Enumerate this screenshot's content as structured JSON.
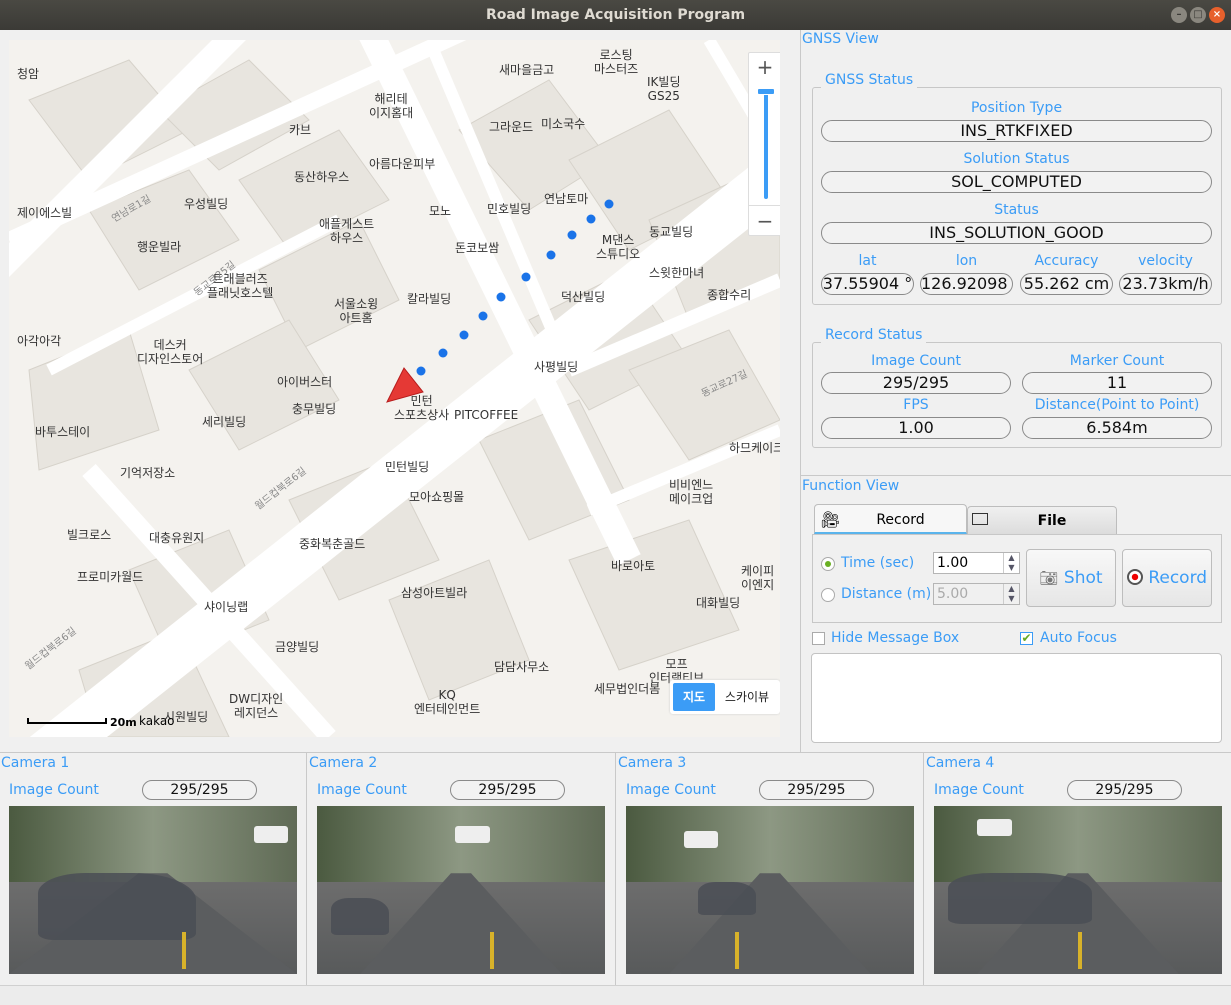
{
  "window": {
    "title": "Road Image Acquisition Program"
  },
  "map": {
    "zoom_in": "+",
    "zoom_out": "−",
    "map_type": {
      "map": "지도",
      "skyview": "스카이뷰",
      "selected": "지도"
    },
    "scale": "20m",
    "brand": "kakao",
    "labels": [
      "청암",
      "해리테\n이지홈대",
      "새마을금고",
      "로스팅\n마스터즈",
      "IK빌딩\nGS25",
      "카브",
      "그라운드",
      "미소국수",
      "아름다운피부",
      "동산하우스",
      "제이에스빌",
      "우성빌딩",
      "연남토마",
      "민호빌딩",
      "모노",
      "애플게스트\n하우스",
      "돈코보쌈",
      "M댄스\n스튜디오",
      "동교빌딩",
      "행운빌라",
      "트래블러즈\n플래닛호스텔",
      "스윗한마녀",
      "종합수리",
      "서울소윙\n아트홈",
      "칼라빌딩",
      "덕산빌딩",
      "아각아각",
      "데스커\n디자인스토어",
      "아이버스터",
      "사평빌딩",
      "충무빌딩",
      "세리빌딩",
      "바투스테이",
      "민턴\n스포츠상사",
      "PITCOFFEE",
      "하므케이크",
      "민턴빌딩",
      "기억저장소",
      "모아쇼핑몰",
      "비비엔느\n메이크업",
      "빌크로스",
      "대충유원지",
      "중화복춘골드",
      "바로아토",
      "케이피\n이엔지",
      "프로미카월드",
      "삼성아트빌라",
      "대화빌딩",
      "샤이닝랩",
      "금양빌딩",
      "담담사무소",
      "모프\n인터랙티브",
      "세무법인더봄",
      "DW디자인\n레지던스",
      "KQ\n엔터테인먼트",
      "시원빌딩"
    ],
    "road_labels": [
      "월드컵북로6길",
      "동교로25길",
      "연남로1길",
      "월드컵북로6길",
      "동교로27길"
    ]
  },
  "gnss_view": {
    "title": "GNSS View",
    "gnss_status": {
      "title": "GNSS Status",
      "position_type": {
        "label": "Position Type",
        "value": "INS_RTKFIXED"
      },
      "solution_status": {
        "label": "Solution Status",
        "value": "SOL_COMPUTED"
      },
      "status": {
        "label": "Status",
        "value": "INS_SOLUTION_GOOD"
      },
      "lat": {
        "label": "lat",
        "value": "37.55904 °"
      },
      "lon": {
        "label": "lon",
        "value": "126.92098 °"
      },
      "accuracy": {
        "label": "Accuracy",
        "value": "55.262 cm"
      },
      "velocity": {
        "label": "velocity",
        "value": "23.73km/h"
      }
    },
    "record_status": {
      "title": "Record Status",
      "image_count": {
        "label": "Image Count",
        "value": "295/295"
      },
      "marker_count": {
        "label": "Marker Count",
        "value": "11"
      },
      "fps": {
        "label": "FPS",
        "value": "1.00"
      },
      "distance": {
        "label": "Distance(Point to Point)",
        "value": "6.584m"
      }
    }
  },
  "function_view": {
    "title": "Function View",
    "tabs": [
      {
        "label": "Record",
        "icon": "video-camera-icon",
        "active": true
      },
      {
        "label": "File",
        "icon": "folder-icon",
        "active": false
      }
    ],
    "time": {
      "label": "Time (sec)",
      "value": "1.00",
      "checked": true
    },
    "distance": {
      "label": "Distance (m)",
      "value": "5.00",
      "checked": false
    },
    "shot_label": "Shot",
    "record_label": "Record",
    "hide_message_box": {
      "label": "Hide Message Box",
      "checked": false
    },
    "auto_focus": {
      "label": "Auto Focus",
      "checked": true
    },
    "message_box": ""
  },
  "cameras": [
    {
      "title": "Camera 1",
      "count_label": "Image Count",
      "count": "295/295"
    },
    {
      "title": "Camera 2",
      "count_label": "Image Count",
      "count": "295/295"
    },
    {
      "title": "Camera 3",
      "count_label": "Image Count",
      "count": "295/295"
    },
    {
      "title": "Camera 4",
      "count_label": "Image Count",
      "count": "295/295"
    }
  ],
  "colors": {
    "accent": "#3b9cf6",
    "track": "#1a73e8",
    "vehicle_marker": "#e53935"
  }
}
